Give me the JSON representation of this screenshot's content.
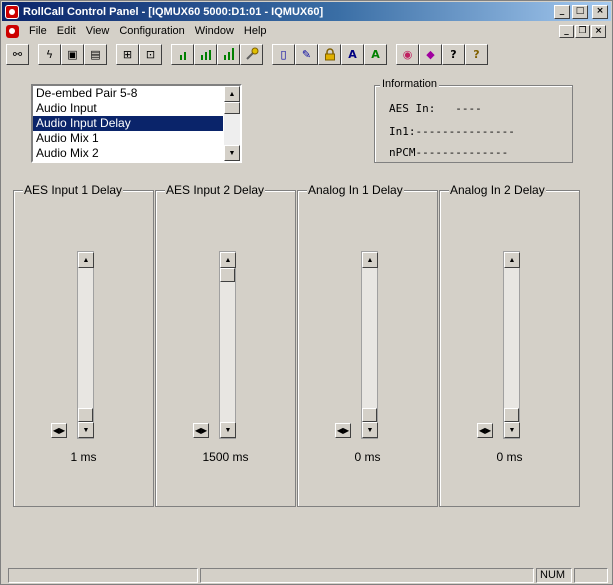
{
  "window": {
    "title": "RollCall Control Panel - [IQMUX60 5000:D1:01 - IQMUX60]",
    "buttons": {
      "minimize": "_",
      "maximize": "□",
      "close": "×"
    },
    "child_buttons": {
      "minimize": "_",
      "restore": "❐",
      "close": "×"
    }
  },
  "menu": [
    "File",
    "Edit",
    "View",
    "Configuration",
    "Window",
    "Help"
  ],
  "toolbar": [
    {
      "icon": "connect-icon",
      "glyph": "⚯"
    },
    {
      "icon": "lightning-icon",
      "glyph": "ϟ"
    },
    {
      "icon": "save-icon",
      "glyph": "▣"
    },
    {
      "icon": "save-all-icon",
      "glyph": "▤"
    },
    {
      "icon": "network-icon",
      "glyph": "⊞"
    },
    {
      "icon": "network-node-icon",
      "glyph": "⊡"
    },
    {
      "icon": "level-low-icon",
      "glyph": ""
    },
    {
      "icon": "level-medium-icon",
      "glyph": ""
    },
    {
      "icon": "level-high-icon",
      "glyph": ""
    },
    {
      "icon": "wrench-icon",
      "glyph": "🔧"
    },
    {
      "icon": "book-icon",
      "glyph": "▯"
    },
    {
      "icon": "edit-icon",
      "glyph": "✎"
    },
    {
      "icon": "lock-icon",
      "glyph": "🔒"
    },
    {
      "icon": "font-a-icon",
      "glyph": "A"
    },
    {
      "icon": "font-a-green-icon",
      "glyph": "A"
    },
    {
      "icon": "globe-icon",
      "glyph": "◉"
    },
    {
      "icon": "diamond-icon",
      "glyph": "◆"
    },
    {
      "icon": "question-book-icon",
      "glyph": "?"
    },
    {
      "icon": "help-icon",
      "glyph": "?"
    }
  ],
  "listbox": {
    "items": [
      "De-embed Pair 5-8",
      "Audio Input",
      "Audio Input Delay",
      "Audio Mix 1",
      "Audio Mix 2"
    ],
    "selected_index": 2
  },
  "information": {
    "title": "Information",
    "lines": [
      "AES In:   ----",
      "In1:---------------",
      "nPCM--------------"
    ]
  },
  "panels": [
    {
      "title": "AES Input 1 Delay",
      "value": "1 ms",
      "level": 0.0
    },
    {
      "title": "AES Input 2 Delay",
      "value": "1500 ms",
      "level": 1.0
    },
    {
      "title": "Analog In 1 Delay",
      "value": "0 ms",
      "level": 0.0
    },
    {
      "title": "Analog In 2 Delay",
      "value": "0 ms",
      "level": 0.0
    }
  ],
  "statusbar": {
    "num": "NUM"
  },
  "colors": {
    "titlebar_start": "#0a246a",
    "selection": "#0a246a",
    "face": "#d4d0c8"
  }
}
